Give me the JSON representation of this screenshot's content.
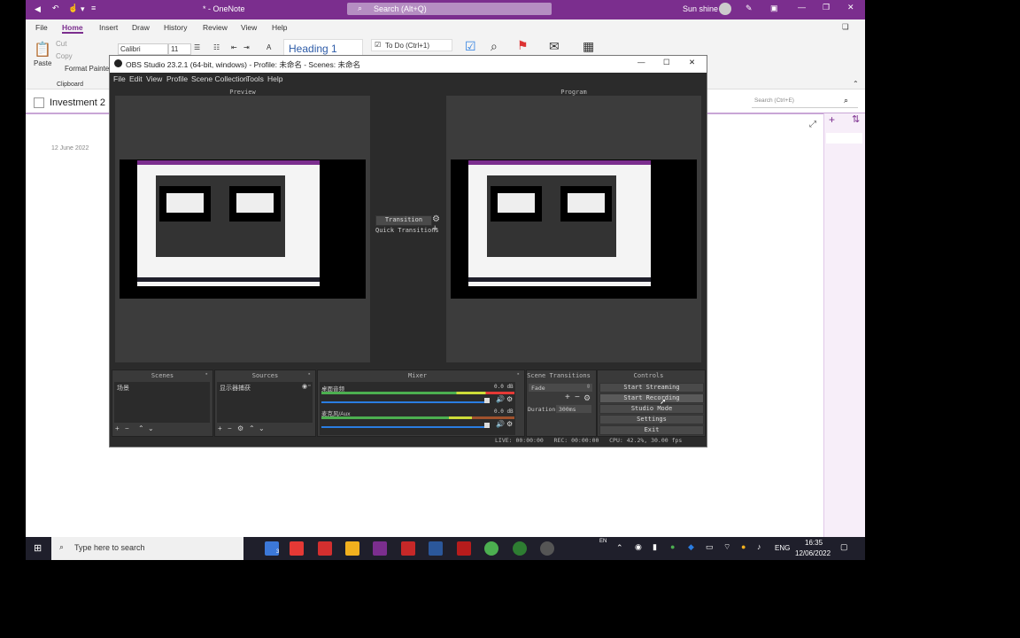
{
  "onenote": {
    "title": "* - OneNote",
    "search_placeholder": "Search (Alt+Q)",
    "user": "Sun shine",
    "tabs": [
      "File",
      "Home",
      "Insert",
      "Draw",
      "History",
      "Review",
      "View",
      "Help"
    ],
    "font_name": "Calibri",
    "font_size": "11",
    "heading_style": "Heading 1",
    "tag_item": "To Do (Ctrl+1)",
    "paste_label": "Paste",
    "cut_label": "Cut",
    "copy_label": "Copy",
    "format_painter_label": "Format Painter",
    "clipboard_group": "Clipboard",
    "page_title": "Investment 2",
    "page_search": "Search (Ctrl+E)",
    "page_date": "12 June 2022",
    "accent": "#7b2e8e"
  },
  "obs": {
    "window_title": "OBS Studio 23.2.1 (64-bit, windows) - Profile: 未命名 - Scenes: 未命名",
    "menu": [
      "File",
      "Edit",
      "View",
      "Profile",
      "Scene Collection",
      "Tools",
      "Help"
    ],
    "preview_label": "Preview",
    "program_label": "Program",
    "transition_btn": "Transition",
    "quick_transitions": "Quick Transitions",
    "docks": {
      "scenes": "Scenes",
      "sources": "Sources",
      "mixer": "Mixer",
      "scene_transitions": "Scene Transitions",
      "controls": "Controls"
    },
    "scene_item": "场景",
    "source_item": "显示器捕获",
    "mixer_tracks": [
      {
        "name": "桌面音频",
        "db": "0.0 dB"
      },
      {
        "name": "麦克风/Aux",
        "db": "0.0 dB"
      }
    ],
    "transition_select": "Fade",
    "duration_label": "Duration",
    "duration_value": "300ms",
    "controls": [
      "Start Streaming",
      "Start Recording",
      "Studio Mode",
      "Settings",
      "Exit"
    ],
    "status": "LIVE: 00:00:00   REC: 00:00:00   CPU: 42.2%, 30.00 fps"
  },
  "taskbar": {
    "search_placeholder": "Type here to search",
    "lang_small": "EN",
    "lang": "ENG",
    "time": "16:35",
    "date": "12/06/2022",
    "badge": "3"
  }
}
